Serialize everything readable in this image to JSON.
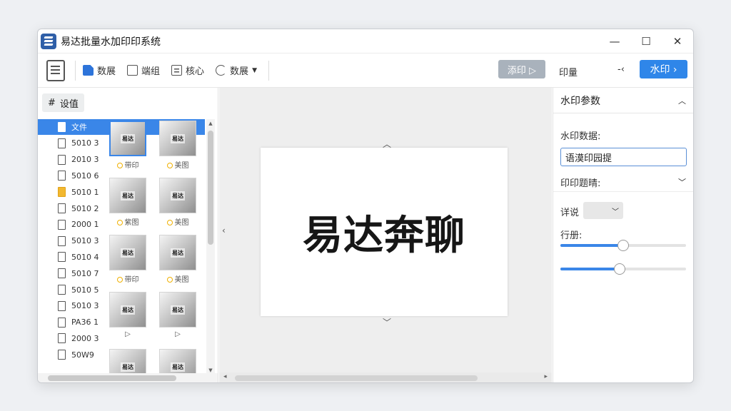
{
  "window": {
    "title": "易达批量水加印印系统",
    "controls": [
      "—",
      "☐",
      "✕"
    ]
  },
  "toolbar": {
    "items": [
      {
        "label": "数展",
        "icon": "file-blue-icon"
      },
      {
        "label": "端组",
        "icon": "frame-icon"
      },
      {
        "label": "核心",
        "icon": "list-icon"
      },
      {
        "label": "数展",
        "icon": "sync-icon"
      }
    ],
    "gray_button": "添印 ▷",
    "right_label": "印量",
    "arrow": "-‹",
    "blue_button": "水印 ›"
  },
  "left": {
    "settings_label": "设值",
    "files": [
      {
        "name": "文件",
        "selected": true
      },
      {
        "name": "5010 3"
      },
      {
        "name": "2010 3"
      },
      {
        "name": "5010 6"
      },
      {
        "name": "5010 1",
        "yellow": true
      },
      {
        "name": "5010 2"
      },
      {
        "name": "2000 1"
      },
      {
        "name": "5010 3"
      },
      {
        "name": "5010 4"
      },
      {
        "name": "5010 7"
      },
      {
        "name": "5010 5"
      },
      {
        "name": "5010 3"
      },
      {
        "name": "PA36 1"
      },
      {
        "name": "2000 3"
      },
      {
        "name": "50W9"
      }
    ],
    "thumbnails": [
      {
        "text": "易达",
        "caption": "带印",
        "selected": true
      },
      {
        "text": "易达",
        "caption": "美图"
      },
      {
        "text": "易达",
        "caption": "紫图"
      },
      {
        "text": "易达",
        "caption": "美图"
      },
      {
        "text": "易达",
        "caption": "带印"
      },
      {
        "text": "易达",
        "caption": "美图"
      },
      {
        "text": "易达",
        "caption": "▷"
      },
      {
        "text": "易达",
        "caption": "▷"
      },
      {
        "text": "易达",
        "caption": ""
      },
      {
        "text": "易达",
        "caption": ""
      }
    ]
  },
  "canvas": {
    "watermark_text": "易达奔聊"
  },
  "right": {
    "header": "水印参数",
    "text_label": "水印数据:",
    "text_value": "语漠印园提",
    "position_label": "印印题晴:",
    "style_label": "详说",
    "opacity_label": "行册:",
    "slider1": 0.5,
    "slider2": 0.47
  },
  "colors": {
    "accent": "#2f86e9",
    "selected_row": "#3a86e8",
    "gray_button": "#a9b2bc"
  }
}
